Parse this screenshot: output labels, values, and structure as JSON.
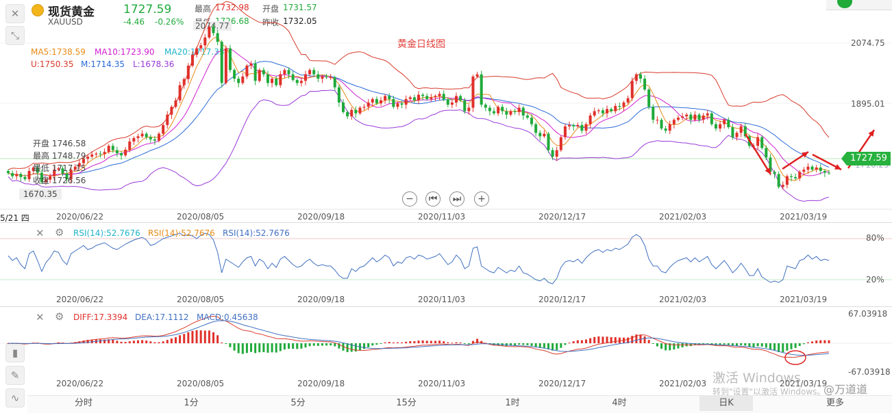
{
  "header": {
    "name": "现货黄金",
    "symbol": "XAUUSD",
    "price": "1727.59",
    "change": "-4.46",
    "change_pct": "-0.26%",
    "high_label": "最高",
    "high_value": "1732.98",
    "low_label": "最低",
    "low_value": "1726.68",
    "open_label": "开盘",
    "open_value": "1731.57",
    "prev_close_label": "昨收",
    "prev_close_value": "1732.05"
  },
  "main_chart": {
    "title": "黄金日线图",
    "ma_legend": {
      "ma5": "MA5:1738.59",
      "ma10": "MA10:1723.90",
      "ma20": "MA20:1717.35"
    },
    "boll_legend": {
      "upper": "U:1750.35",
      "mid": "M:1714.35",
      "lower": "L:1678.36"
    },
    "y_ticks": [
      "2074.75",
      "1895.01"
    ],
    "max_marker": "2074.77",
    "min_marker": "1670.35",
    "price_tag": "1727.59",
    "hidden_tick": "1716.25",
    "cursor_date": "5/21 四",
    "ohlc_box": {
      "open": "开盘 1746.58",
      "high": "最高 1748.79",
      "low": "最低 1717.15",
      "close": "收盘 1726.56"
    }
  },
  "date_labels": [
    "2020/06/22",
    "2020/08/05",
    "2020/09/18",
    "2020/11/03",
    "2020/12/17",
    "2021/02/03",
    "2021/03/19"
  ],
  "rsi_panel": {
    "label1": "RSI(14):52.7676",
    "label2": "RSI(14):52.7676",
    "label3": "RSI(14):52.7676",
    "tick_high": "80%",
    "tick_low": "20%"
  },
  "macd_panel": {
    "diff": "DIFF:17.3394",
    "dea": "DEA:17.1112",
    "macd": "MACD:0.45638",
    "tick_high": "67.03918",
    "tick_low": "-67.03918"
  },
  "timeframes": [
    "分时",
    "1分",
    "5分",
    "15分",
    "1时",
    "4时",
    "日K",
    "更多"
  ],
  "active_timeframe": "日K",
  "watermark": {
    "line1": "激活 Windows",
    "line2": "转到\"设置\"以激活 Windows。",
    "tag": "@万道道"
  },
  "colors": {
    "up": "#e0302a",
    "down": "#1faa3a",
    "ma5": "#e88a17",
    "ma10": "#d01fd0",
    "ma20": "#1fb3c8",
    "boll_upper": "#d83a2a",
    "boll_mid": "#2a6ad8",
    "boll_lower": "#9a3ad8",
    "rsi": "#3f6fc0",
    "diff": "#3f6fc0",
    "dea": "#d83a2a"
  },
  "chart_data": [
    {
      "type": "candlestick",
      "title": "黄金日线图",
      "x_range": [
        "2020/05/21",
        "2021/04/01"
      ],
      "y_ticks": [
        2074.75,
        1895.01
      ],
      "ylim": [
        1650,
        2095
      ],
      "close": [
        1727,
        1720,
        1725,
        1718,
        1713,
        1732,
        1740,
        1728,
        1706,
        1712,
        1720,
        1735,
        1738,
        1726,
        1713,
        1735,
        1742,
        1750,
        1760,
        1765,
        1770,
        1772,
        1771,
        1776,
        1790,
        1780,
        1773,
        1768,
        1781,
        1800,
        1808,
        1812,
        1818,
        1810,
        1805,
        1802,
        1818,
        1838,
        1862,
        1880,
        1895,
        1930,
        1944,
        1975,
        2000,
        2015,
        2022,
        2040,
        2065,
        2050,
        2030,
        1935,
        2015,
        1965,
        1945,
        1935,
        1950,
        1975,
        1980,
        1940,
        1965,
        1955,
        1935,
        1945,
        1930,
        1955,
        1965,
        1955,
        1942,
        1935,
        1940,
        1955,
        1965,
        1955,
        1945,
        1950,
        1948,
        1948,
        1925,
        1890,
        1868,
        1858,
        1873,
        1865,
        1878,
        1880,
        1890,
        1898,
        1888,
        1895,
        1905,
        1898,
        1880,
        1888,
        1885,
        1898,
        1902,
        1895,
        1908,
        1905,
        1898,
        1902,
        1905,
        1910,
        1897,
        1885,
        1890,
        1905,
        1895,
        1870,
        1878,
        1950,
        1955,
        1885,
        1878,
        1870,
        1865,
        1880,
        1870,
        1862,
        1870,
        1868,
        1878,
        1860,
        1855,
        1840,
        1820,
        1812,
        1818,
        1780,
        1765,
        1780,
        1810,
        1835,
        1838,
        1835,
        1838,
        1825,
        1840,
        1860,
        1870,
        1872,
        1865,
        1875,
        1870,
        1882,
        1880,
        1890,
        1900,
        1940,
        1955,
        1945,
        1920,
        1880,
        1850,
        1850,
        1830,
        1825,
        1840,
        1850,
        1855,
        1858,
        1862,
        1850,
        1862,
        1850,
        1860,
        1865,
        1840,
        1830,
        1840,
        1850,
        1833,
        1810,
        1820,
        1835,
        1812,
        1790,
        1790,
        1810,
        1785,
        1763,
        1730,
        1725,
        1695,
        1700,
        1720,
        1718,
        1715,
        1730,
        1735,
        1742,
        1735,
        1740,
        1732,
        1728,
        1727
      ]
    },
    {
      "type": "line",
      "title": "RSI(14)",
      "ylim": [
        0,
        100
      ],
      "y_ticks": [
        "80%",
        "20%"
      ],
      "series": [
        {
          "name": "RSI(14)",
          "values": [
            55,
            48,
            52,
            42,
            36,
            58,
            62,
            48,
            32,
            45,
            52,
            62,
            60,
            48,
            42,
            58,
            62,
            66,
            70,
            64,
            66,
            70,
            72,
            74,
            70,
            66,
            64,
            68,
            72,
            75,
            78,
            80,
            82,
            78,
            70,
            72,
            76,
            80,
            82,
            84,
            86,
            88,
            84,
            86,
            84,
            80,
            85,
            88,
            86,
            78,
            60,
            30,
            50,
            46,
            42,
            38,
            46,
            52,
            54,
            40,
            50,
            46,
            36,
            44,
            38,
            50,
            54,
            48,
            42,
            38,
            40,
            46,
            50,
            44,
            40,
            42,
            40,
            40,
            34,
            26,
            22,
            22,
            36,
            32,
            38,
            40,
            46,
            52,
            46,
            50,
            56,
            52,
            40,
            46,
            44,
            52,
            54,
            50,
            56,
            54,
            50,
            52,
            54,
            58,
            50,
            42,
            46,
            56,
            50,
            36,
            40,
            66,
            68,
            40,
            36,
            32,
            30,
            38,
            34,
            30,
            34,
            32,
            40,
            30,
            28,
            24,
            20,
            18,
            22,
            16,
            14,
            22,
            38,
            46,
            48,
            46,
            50,
            44,
            52,
            58,
            62,
            64,
            60,
            64,
            62,
            66,
            64,
            68,
            72,
            82,
            86,
            82,
            70,
            50,
            40,
            40,
            32,
            30,
            38,
            44,
            48,
            50,
            52,
            46,
            52,
            46,
            50,
            54,
            42,
            36,
            42,
            48,
            40,
            30,
            36,
            44,
            36,
            26,
            26,
            36,
            24,
            20,
            16,
            18,
            16,
            20,
            40,
            38,
            36,
            48,
            50,
            56,
            50,
            54,
            48,
            50,
            48
          ]
        }
      ]
    },
    {
      "type": "bar+line",
      "title": "MACD",
      "ylim": [
        -67.03918,
        67.03918
      ],
      "series": [
        {
          "name": "DIFF",
          "values": [
            17.34
          ]
        },
        {
          "name": "DEA",
          "values": [
            17.11
          ]
        },
        {
          "name": "MACD",
          "values": [
            0.456
          ]
        }
      ]
    }
  ]
}
